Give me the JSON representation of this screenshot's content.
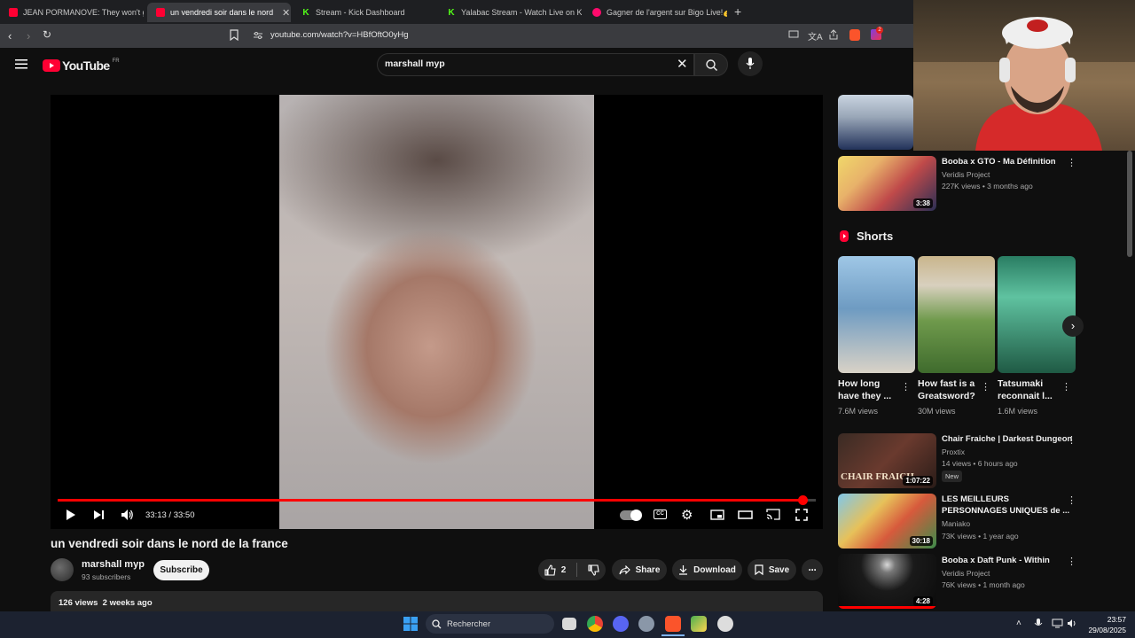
{
  "browser": {
    "tabs": [
      {
        "label": "JEAN PORMANOVE: They won't get",
        "favicon": "youtube-icon",
        "active": false
      },
      {
        "label": "un vendredi soir dans le nord de",
        "favicon": "youtube-icon",
        "active": true
      },
      {
        "label": "Stream - Kick Dashboard",
        "favicon": "kick-icon",
        "active": false
      },
      {
        "label": "Yalabac Stream - Watch Live on Kick",
        "favicon": "kick-icon",
        "active": false
      },
      {
        "label": "Gagner de l'argent sur Bigo Live!💰",
        "favicon": "bigo-icon",
        "active": false
      }
    ],
    "new_tab": "+",
    "url": "youtube.com/watch?v=HBfOftO0yHg",
    "brave_badge": "2"
  },
  "youtube": {
    "logo_text": "YouTube",
    "region": "FR",
    "search_value": "marshall myp"
  },
  "player": {
    "time_current": "33:13",
    "time_separator": "/",
    "time_total": "33:50",
    "progress_fraction": 0.982
  },
  "video": {
    "title": "un vendredi soir dans le nord de la france",
    "channel": "marshall myp",
    "subscribers": "93 subscribers",
    "subscribe_label": "Subscribe",
    "likes": "2",
    "share_label": "Share",
    "download_label": "Download",
    "save_label": "Save",
    "views": "126 views",
    "posted": "2 weeks ago"
  },
  "sidebar": {
    "top_videos": [
      {
        "title": "Booba x GTO - Ma Définition",
        "channel": "Veridis Project",
        "meta": "227K views • 3 months ago",
        "duration": "3:38"
      }
    ],
    "shorts_label": "Shorts",
    "shorts": [
      {
        "title1": "How long",
        "title2": "have they ...",
        "views": "7.6M views"
      },
      {
        "title1": "How fast is a",
        "title2": "Greatsword?",
        "views": "30M views"
      },
      {
        "title1": "Tatsumaki",
        "title2": "reconnait l...",
        "views": "1.6M views"
      }
    ],
    "videos": [
      {
        "title1": "Chair Fraiche | Darkest Dungeon",
        "title2": "",
        "channel": "Proxtix",
        "meta": "14 views • 6 hours ago",
        "badge": "New",
        "duration": "1:07:22",
        "thumb_text": "CHAIR FRAICH"
      },
      {
        "title1": "LES MEILLEURS",
        "title2": "PERSONNAGES UNIQUES de ...",
        "channel": "Maniako",
        "meta": "73K views • 1 year ago",
        "duration": "30:18"
      },
      {
        "title1": "Booba x Daft Punk - Within",
        "title2": "",
        "channel": "Veridis Project",
        "meta": "76K views • 1 month ago",
        "duration": "4:28"
      }
    ]
  },
  "taskbar": {
    "search_placeholder": "Rechercher",
    "time": "23:57",
    "date": "29/08/2025"
  },
  "colors": {
    "accent_red": "#ff0000",
    "background": "#0f0f0f",
    "surface": "#272727"
  }
}
